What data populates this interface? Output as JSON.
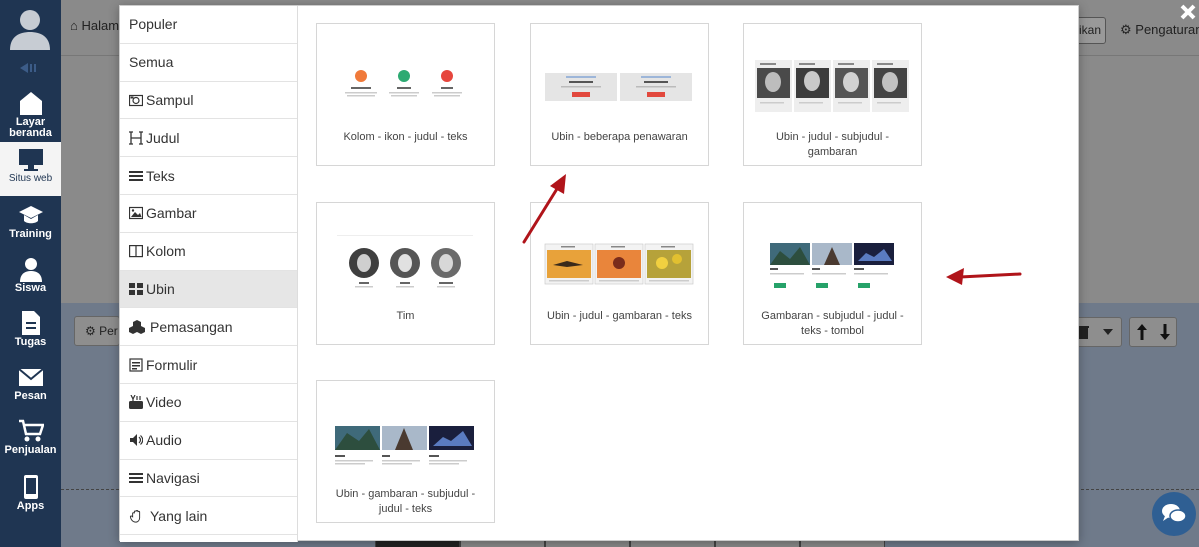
{
  "sidebar": {
    "items": [
      {
        "label": "Layar beranda",
        "icon": "home-icon"
      },
      {
        "label": "Situs web",
        "icon": "monitor-icon"
      },
      {
        "label": "Training",
        "icon": "graduation-cap-icon"
      },
      {
        "label": "Siswa",
        "icon": "user-icon"
      },
      {
        "label": "Tugas",
        "icon": "document-icon"
      },
      {
        "label": "Pesan",
        "icon": "envelope-icon"
      },
      {
        "label": "Penjualan",
        "icon": "cart-icon"
      },
      {
        "label": "Apps",
        "icon": "mobile-icon"
      }
    ]
  },
  "background": {
    "home_label": "Halam",
    "right_button_label": "ikan",
    "settings_label": "Pengaturan",
    "per_label": "Per"
  },
  "categories": [
    {
      "label": "Populer",
      "icon": ""
    },
    {
      "label": "Semua",
      "icon": ""
    },
    {
      "label": "Sampul",
      "icon": "camera-icon"
    },
    {
      "label": "Judul",
      "icon": "header-icon"
    },
    {
      "label": "Teks",
      "icon": "align-justify-icon"
    },
    {
      "label": "Gambar",
      "icon": "image-icon"
    },
    {
      "label": "Kolom",
      "icon": "columns-icon"
    },
    {
      "label": "Ubin",
      "icon": "th-large-icon"
    },
    {
      "label": "Pemasangan",
      "icon": "cubes-icon"
    },
    {
      "label": "Formulir",
      "icon": "form-icon"
    },
    {
      "label": "Video",
      "icon": "youtube-icon"
    },
    {
      "label": "Audio",
      "icon": "volume-icon"
    },
    {
      "label": "Navigasi",
      "icon": "bars-icon"
    },
    {
      "label": "Yang lain",
      "icon": "hand-icon"
    }
  ],
  "active_category": "Ubin",
  "tiles": [
    {
      "label": "Kolom - ikon - judul - teks"
    },
    {
      "label": "Ubin - beberapa penawaran"
    },
    {
      "label": "Ubin - judul - subjudul - gambaran"
    },
    {
      "label": "Tim"
    },
    {
      "label": "Ubin - judul - gambaran - teks"
    },
    {
      "label": "Gambaran - subjudul - judul - teks - tombol"
    },
    {
      "label": "Ubin - gambaran - subjudul - judul - teks"
    }
  ],
  "colors": {
    "sidebar_bg": "#1f3552",
    "annotation_arrow": "#b0141a",
    "button_red": "#e2483d",
    "button_green": "#26a269"
  }
}
